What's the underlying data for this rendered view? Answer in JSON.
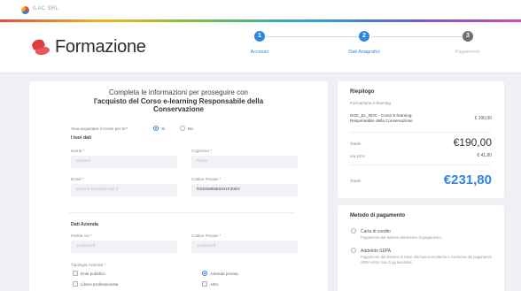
{
  "topbar": {
    "brand_small": "ILAC SRL"
  },
  "header": {
    "brand_name": "Formazione",
    "steps": [
      {
        "num": "1",
        "label": "Accesso",
        "state": "active"
      },
      {
        "num": "2",
        "label": "Dati Anagrafici",
        "state": "active"
      },
      {
        "num": "3",
        "label": "Pagamento",
        "state": "todo"
      }
    ]
  },
  "form": {
    "title_line1": "Completa le informazioni per proseguire con",
    "title_line2": "l'acquisto del Corso e-learning Responsabile della",
    "title_line3": "Conservazione",
    "purchase_question": "Vuoi acquistare il Corso per te?",
    "radio_yes": "Sì",
    "radio_no": "No",
    "section_personal": "I tuoi dati",
    "label_nome": "Nome *",
    "value_nome": "Simone",
    "label_cognome": "Cognome *",
    "value_cognome": "Rossi",
    "label_email": "Email *",
    "value_email": "simone.rossi@email.it",
    "label_cf": "Codice Fiscale *",
    "value_cf": "RSSSMN80H01F205V",
    "section_company": "Dati Azienda",
    "label_piva": "Partita Iva *",
    "value_piva": "12345678",
    "label_cf_company": "Codice Fiscale *",
    "value_cf_company": "12345678",
    "label_tipologia": "Tipologia Azienda *",
    "tipologia_opt1": "Ente pubblico",
    "tipologia_opt2": "Azienda privata",
    "tipologia_opt3": "Libero professionista",
    "tipologia_opt4": "Altro"
  },
  "summary": {
    "title": "Riepilogo",
    "subtitle": "Formazione e-learning",
    "item_name_line1": "DOC_EL_RDC - Corso E-learning",
    "item_name_line2": "Responsabile della Conservazione",
    "item_price": "€ 190,00",
    "label_subtotal": "Totale",
    "subtotal": "€190,00",
    "label_vat": "Iva 22%",
    "vat": "€ 41,80",
    "label_total": "Totale",
    "total": "€231,80"
  },
  "payment": {
    "title": "Metodo di pagamento",
    "opt1_label": "Carta di credito",
    "opt1_desc": "Pagamento dal sistema elettronico di pagamento.",
    "opt2_label": "Addebito SEPA",
    "opt2_desc": "Pagamento dal sistema in base alla banca emittente e conferma del pagamento SEPA entro max 5 gg lavorativi."
  },
  "colors": {
    "accent": "#2e86de",
    "brand_red": "#e6393f"
  }
}
